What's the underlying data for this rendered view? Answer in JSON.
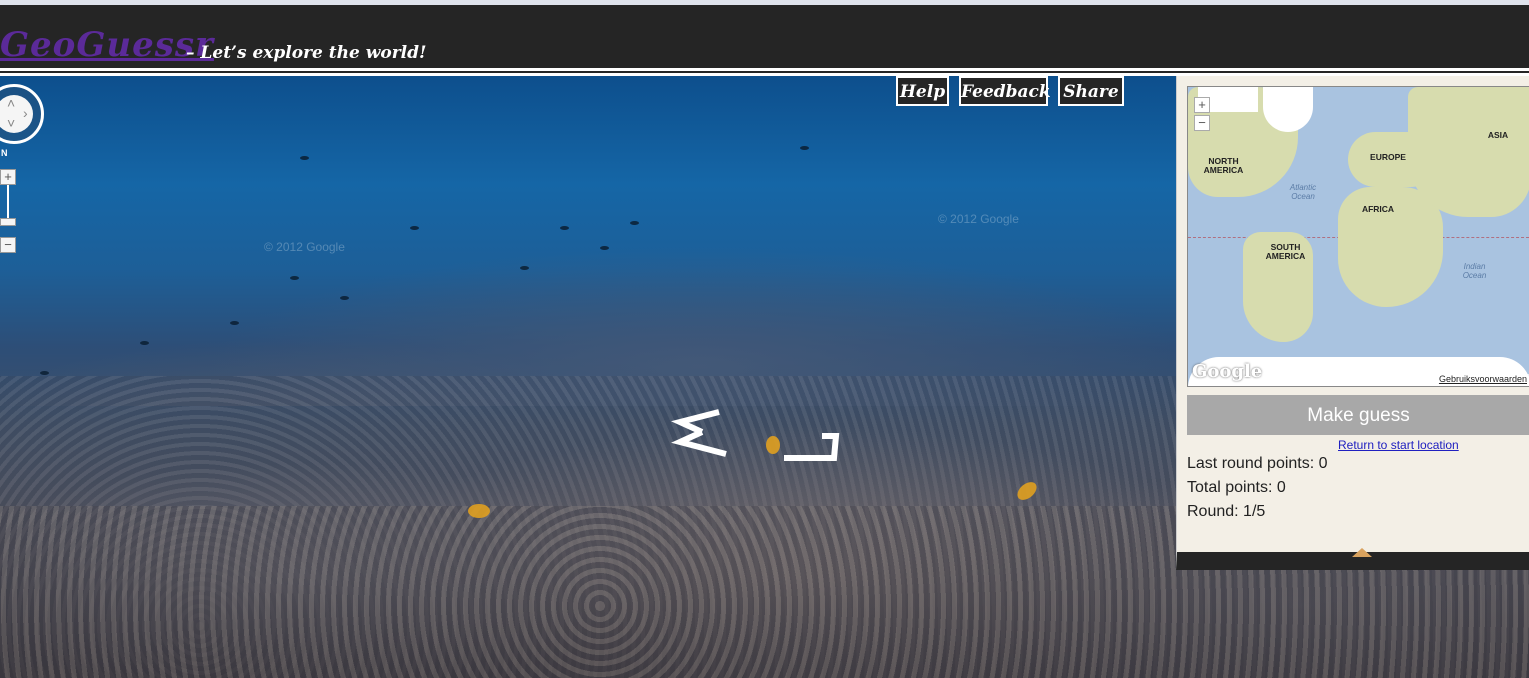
{
  "header": {
    "logo": "GeoGuessr",
    "tagline": "– Let’s explore the world!"
  },
  "nav": {
    "help": "Help",
    "feedback": "Feedback",
    "share": "Share"
  },
  "streetview": {
    "watermark": "© 2012 Google",
    "compass_label": "N",
    "zoom_in": "+",
    "zoom_out": "−"
  },
  "minimap": {
    "zoom_in": "+",
    "zoom_out": "−",
    "labels": {
      "north_america": "NORTH AMERICA",
      "south_america": "SOUTH AMERICA",
      "europe": "EUROPE",
      "africa": "AFRICA",
      "asia": "ASIA",
      "atlantic": "Atlantic Ocean",
      "indian": "Indian Ocean"
    },
    "google_logo": "Google",
    "terms_link": "Gebruiksvoorwaarden"
  },
  "guess": {
    "make_guess": "Make guess",
    "return_link": "Return to start location",
    "last_round_points": "Last round points: 0",
    "total_points": "Total points: 0",
    "round": "Round: 1/5"
  },
  "colors": {
    "header_bg": "#252525",
    "logo": "#5b2a99",
    "button_gray": "#a8a8a8",
    "panel_bg": "#f3efe6"
  }
}
